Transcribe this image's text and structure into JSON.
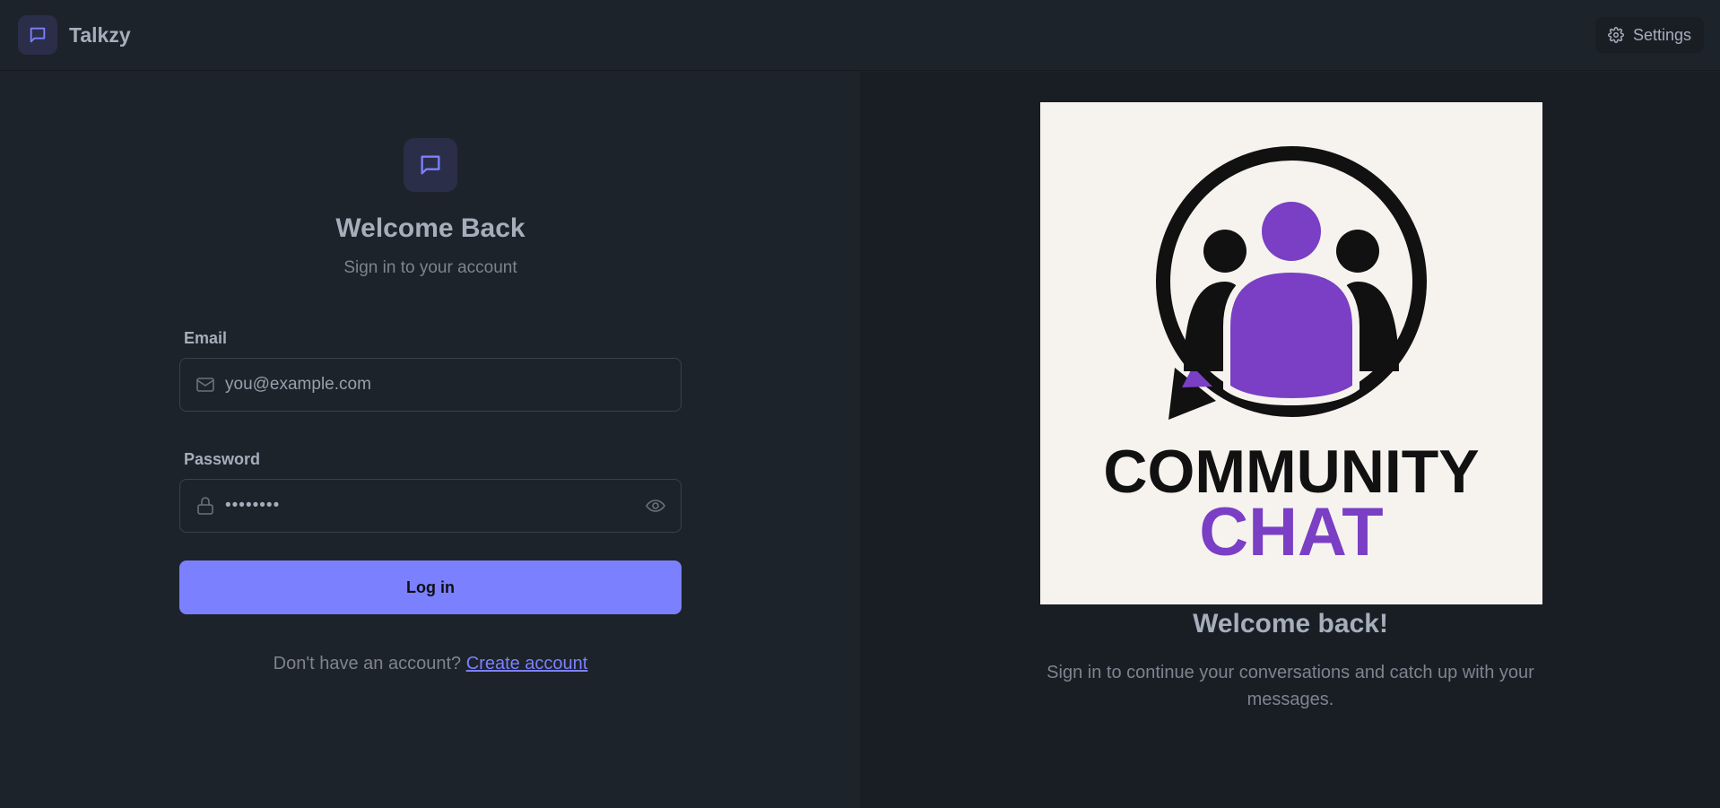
{
  "app": {
    "name": "Talkzy",
    "settings_label": "Settings"
  },
  "login": {
    "title": "Welcome Back",
    "subtitle": "Sign in to your account",
    "email_label": "Email",
    "email_placeholder": "you@example.com",
    "password_label": "Password",
    "password_value": "••••••••",
    "submit_label": "Log in",
    "signup_prompt": "Don't have an account?",
    "signup_link": "Create account"
  },
  "hero": {
    "logo_line1": "COMMUNITY",
    "logo_line2": "CHAT",
    "title": "Welcome back!",
    "text": "Sign in to continue your conversations and catch up with your messages."
  },
  "colors": {
    "background": "#1d232a",
    "panel_right": "#191e24",
    "accent": "#7b80ff",
    "logo_purple": "#7a3fc4",
    "logo_black": "#111111",
    "hero_bg": "#f6f3ef"
  },
  "icons": {
    "brand": "chat-bubble-icon",
    "settings": "gear-icon",
    "email": "mail-icon",
    "password": "lock-icon",
    "toggle_password": "eye-icon"
  }
}
